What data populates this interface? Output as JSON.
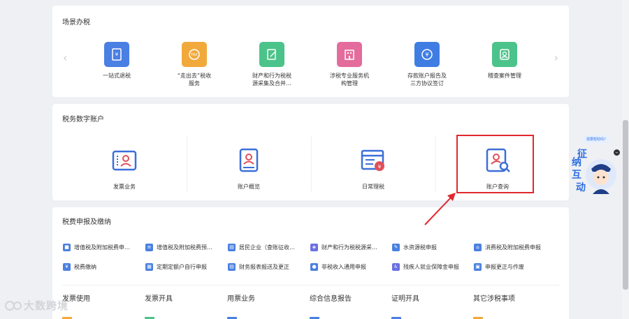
{
  "scene": {
    "title": "场景办税",
    "items": [
      {
        "label": "一站式退税",
        "color": "#4a7fe3",
        "icon": "receipt-icon"
      },
      {
        "label": "“走出去”税收\n服务",
        "color": "#f2a93b",
        "icon": "tax-globe-icon"
      },
      {
        "label": "财产和行为税税\n源采集及合并…",
        "color": "#4cc38a",
        "icon": "edit-doc-icon"
      },
      {
        "label": "涉税专业服务机\n构管理",
        "color": "#e36c9c",
        "icon": "building-icon"
      },
      {
        "label": "存款账户报告及\n三方协议签订",
        "color": "#3f7de3",
        "icon": "yuan-badge-icon"
      },
      {
        "label": "稽查案件管理",
        "color": "#4cc38a",
        "icon": "person-card-icon"
      }
    ]
  },
  "account": {
    "title": "税务数字账户",
    "items": [
      {
        "label": "发票业务",
        "icon": "invoice-user-icon"
      },
      {
        "label": "账户概览",
        "icon": "account-book-icon"
      },
      {
        "label": "日常理税",
        "icon": "calendar-tax-icon"
      },
      {
        "label": "账户查询",
        "icon": "account-search-icon"
      }
    ]
  },
  "declare": {
    "title": "税费申报及缴纳",
    "row1": [
      {
        "label": "增值税及附加税费申…",
        "color": "#4a80e0"
      },
      {
        "label": "增值税及附加税费预…",
        "color": "#4a80e0"
      },
      {
        "label": "居民企业（查账征收…",
        "color": "#4a80e0"
      },
      {
        "label": "财产和行为税税源采…",
        "color": "#6b6fe0"
      },
      {
        "label": "水资源税申报",
        "color": "#4a80e0"
      },
      {
        "label": "消费税及附加税费申报",
        "color": "#4a80e0"
      }
    ],
    "row2": [
      {
        "label": "税费缴纳",
        "color": "#4a80e0"
      },
      {
        "label": "定期定额户自行申报",
        "color": "#4a80e0"
      },
      {
        "label": "财务报表报送及更正",
        "color": "#4a80e0"
      },
      {
        "label": "非税收入通用申报",
        "color": "#4a80e0"
      },
      {
        "label": "残疾人就业保障金申报",
        "color": "#6b6fe0"
      },
      {
        "label": "申报更正与作废",
        "color": "#4a80e0"
      }
    ],
    "tabs": [
      "发票使用",
      "发票开具",
      "用票业务",
      "综合信息报告",
      "证明开具",
      "其它涉税事项"
    ]
  },
  "assistant": {
    "bubble": "需要帮助吗?",
    "chars": [
      "征",
      "纳",
      "互",
      "动"
    ]
  },
  "watermark": {
    "text": "大数跨境"
  }
}
